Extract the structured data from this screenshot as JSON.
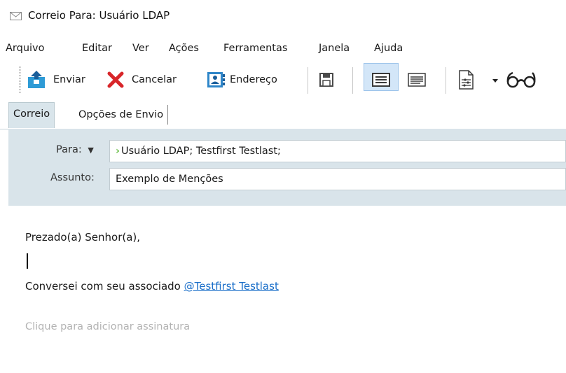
{
  "window": {
    "title": "Correio Para: Usuário LDAP"
  },
  "menu": [
    "Arquivo",
    "Editar",
    "Ver",
    "Ações",
    "Ferramentas",
    "Janela",
    "Ajuda"
  ],
  "toolbar": {
    "send_label": "Enviar",
    "cancel_label": "Cancelar",
    "address_label": "Endereço"
  },
  "tabs": {
    "mail": "Correio",
    "send_options": "Opções de Envio"
  },
  "compose": {
    "to_label": "Para:",
    "to_value": "Usuário LDAP;  Testfirst Testlast;",
    "subject_label": "Assunto:",
    "subject_value": "Exemplo de Menções"
  },
  "body": {
    "greeting": "Prezado(a) Senhor(a),",
    "text_before_mention": "Conversei com seu associado ",
    "mention": "@Testfirst  Testlast",
    "signature_placeholder": "Clique para adicionar assinatura"
  },
  "colors": {
    "accent": "#1b6fc9",
    "header_bg": "#d9e4ea",
    "cancel_red": "#d8262a"
  }
}
